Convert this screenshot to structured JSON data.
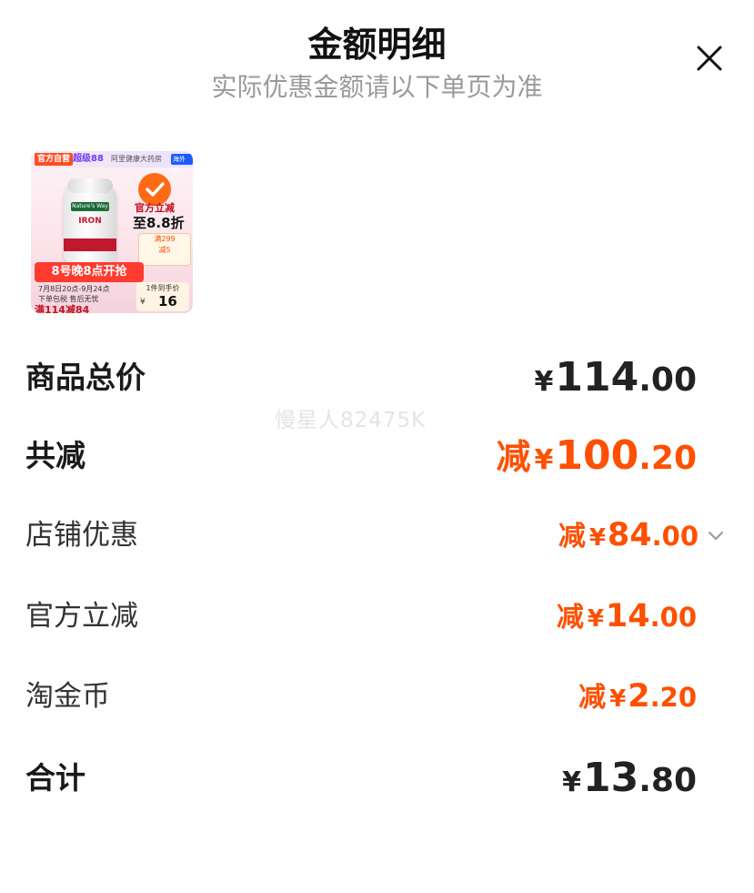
{
  "header": {
    "title": "金额明细",
    "subtitle": "实际优惠金额请以下单页为准"
  },
  "product_thumb": {
    "tag_self": "官方自营",
    "tag_super": "超级88",
    "tag_store": "阿里健康大药房",
    "tag_hk": "海外店",
    "brand": "Nature's Way",
    "product_name": "IRON",
    "offer_line1": "官方立减",
    "offer_line2": "至8.8折",
    "coupon_line1": "满299",
    "coupon_line2": "减5",
    "promo_banner": "8号晚8点开抢",
    "promo_dates": "7月8日20点-9月24点",
    "promo_sub": "下单包税 售后无忧",
    "promo_deal": "满114减84",
    "price_label": "1件到手价",
    "price_currency": "¥",
    "price_value": "16"
  },
  "rows": {
    "total": {
      "label": "商品总价",
      "currency": "¥",
      "integer": "114",
      "decimal": ".00"
    },
    "discount": {
      "label": "共减",
      "prefix": "减",
      "currency": "¥",
      "integer": "100",
      "decimal": ".20"
    },
    "store_discount": {
      "label": "店铺优惠",
      "prefix": "减",
      "currency": "¥",
      "integer": "84",
      "decimal": ".00"
    },
    "official_discount": {
      "label": "官方立减",
      "prefix": "减",
      "currency": "¥",
      "integer": "14",
      "decimal": ".00"
    },
    "coins": {
      "label": "淘金币",
      "prefix": "减",
      "currency": "¥",
      "integer": "2",
      "decimal": ".20"
    },
    "sum": {
      "label": "合计",
      "currency": "¥",
      "integer": "13",
      "decimal": ".80"
    }
  },
  "watermark": "慢星人82475K",
  "colors": {
    "accent": "#ff5000",
    "text": "#1a1a1a",
    "muted": "#9a9a9a"
  },
  "icons": {
    "close": "close-icon",
    "expand": "chevron-down-icon"
  }
}
